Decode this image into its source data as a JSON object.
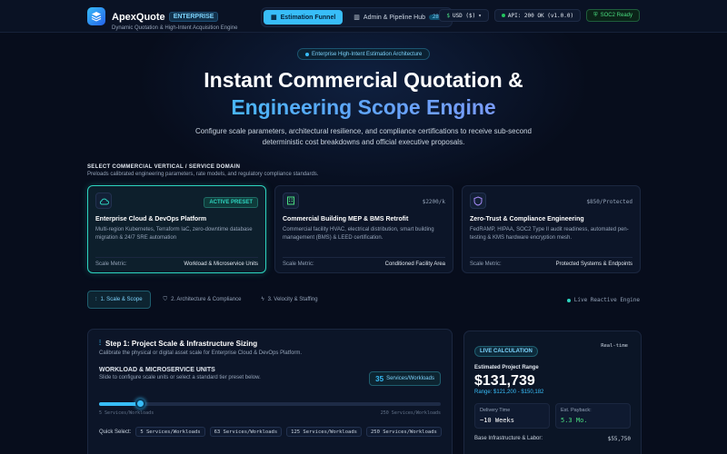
{
  "header": {
    "brand": "ApexQuote",
    "badge": "ENTERPRISE",
    "subtitle": "Dynamic Quotation & High-Intent Acquisition Engine",
    "tabs": [
      {
        "label": "Estimation Funnel",
        "active": true
      },
      {
        "label": "Admin & Pipeline Hub",
        "count": "28"
      }
    ],
    "currency": "USD ($)",
    "api_status": "API: 200 OK (v1.0.0)",
    "compliance": "SOC2 Ready"
  },
  "hero": {
    "tag": "Enterprise High-Intent Estimation Architecture",
    "title_line1": "Instant Commercial Quotation &",
    "title_line2": "Engineering Scope Engine",
    "description": "Configure scale parameters, architectural resilience, and compliance certifications to receive sub-second deterministic cost breakdowns and official executive proposals."
  },
  "verticals": {
    "title": "SELECT COMMERCIAL VERTICAL / SERVICE DOMAIN",
    "subtitle": "Preloads calibrated engineering parameters, rate models, and regulatory compliance standards.",
    "cards": [
      {
        "icon": "cloud-icon",
        "tag": "ACTIVE PRESET",
        "title": "Enterprise Cloud & DevOps Platform",
        "description": "Multi-region Kubernetes, Terraform IaC, zero-downtime database migration & 24/7 SRE automation",
        "metric_label": "Scale Metric:",
        "metric_value": "Workload & Microservice Units"
      },
      {
        "icon": "building-icon",
        "tag": "$2200/k",
        "title": "Commercial Building MEP & BMS Retrofit",
        "description": "Commercial facility HVAC, electrical distribution, smart building management (BMS) & LEED certification.",
        "metric_label": "Scale Metric:",
        "metric_value": "Conditioned Facility Area"
      },
      {
        "icon": "shield-icon",
        "tag": "$850/Protected",
        "title": "Zero-Trust & Compliance Engineering",
        "description": "FedRAMP, HIPAA, SOC2 Type II audit readiness, automated pen-testing & KMS hardware encryption mesh.",
        "metric_label": "Scale Metric:",
        "metric_value": "Protected Systems & Endpoints"
      }
    ]
  },
  "steps": [
    {
      "label": "1. Scale & Scope",
      "icon": "sliders-icon"
    },
    {
      "label": "2. Architecture & Compliance",
      "icon": "shield-icon"
    },
    {
      "label": "3. Velocity & Staffing",
      "icon": "bolt-icon"
    }
  ],
  "live_engine": "Live Reactive Engine",
  "step_panel": {
    "title": "Step 1: Project Scale & Infrastructure Sizing",
    "subtitle": "Calibrate the physical or digital asset scale for Enterprise Cloud & DevOps Platform.",
    "workload_title": "WORKLOAD & MICROSERVICE UNITS",
    "workload_sub": "Slide to configure scale units or select a standard tier preset below.",
    "value_number": "35",
    "value_unit": "Services/Workloads",
    "slider_fraction": 0.12,
    "range_min": "5 Services/Workloads",
    "range_max": "250 Services/Workloads",
    "quick_label": "Quick Select:",
    "quick_options": [
      "5 Services/Workloads",
      "63 Services/Workloads",
      "125 Services/Workloads",
      "250 Services/Workloads"
    ]
  },
  "calc": {
    "badge": "LIVE CALCULATION",
    "realtime": "Real-time",
    "label": "Estimated Project Range",
    "value": "$131,739",
    "range": "Range: $121,200 - $150,182",
    "delivery_label": "Delivery Time",
    "delivery_value": "~10 Weeks",
    "payback_label": "Est. Payback:",
    "payback_value": "5.3 Mo.",
    "base_label": "Base Infrastructure & Labor:",
    "base_value": "$55,750"
  },
  "colors": {
    "accent": "#38bdf8",
    "teal": "#2dd4bf",
    "green": "#4ade80",
    "bg": "#070d1c"
  }
}
